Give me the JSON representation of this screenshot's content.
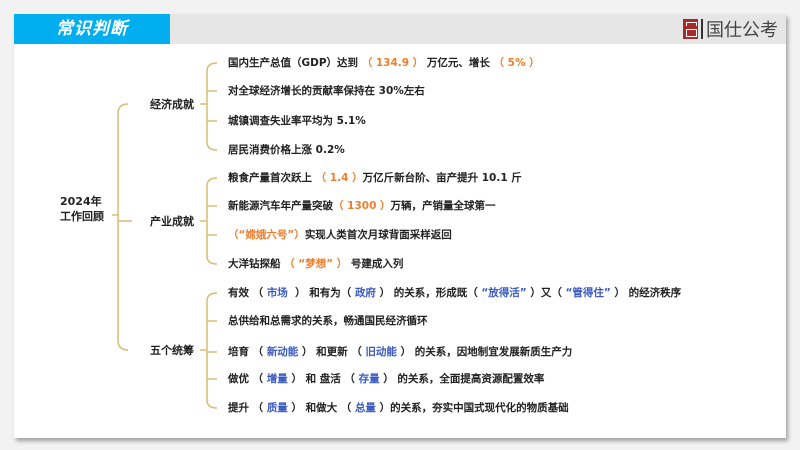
{
  "header": {
    "title": "常识判断",
    "logo_text": "国仕公考"
  },
  "colors": {
    "accent": "#00aeef",
    "orange": "#f07d2a",
    "blue": "#3b5bbf",
    "tree_line": "#d8bd72"
  },
  "root": {
    "label": "2024年工作回顾"
  },
  "branches": [
    {
      "label": "经济成就",
      "items": [
        [
          {
            "t": "国内生产总值（GDP）达到 "
          },
          {
            "t": "（ 134.9 ）",
            "h": "o"
          },
          {
            "t": " 万亿元、增长 "
          },
          {
            "t": "（ 5% ）",
            "h": "o"
          }
        ],
        [
          {
            "t": "对全球经济增长的贡献率保持在 30%左右"
          }
        ],
        [
          {
            "t": "城镇调查失业率平均为 5.1%"
          }
        ],
        [
          {
            "t": "居民消费价格上涨 0.2%"
          }
        ]
      ]
    },
    {
      "label": "产业成就",
      "items": [
        [
          {
            "t": "粮食产量首次跃上 "
          },
          {
            "t": "（ 1.4 ）",
            "h": "o"
          },
          {
            "t": "万亿斤新台阶、亩产提升 10.1 斤"
          }
        ],
        [
          {
            "t": "新能源汽车年产量突破"
          },
          {
            "t": "（ 1300 ）",
            "h": "o"
          },
          {
            "t": "万辆，产销量全球第一"
          }
        ],
        [
          {
            "t": "（“嫦娥六号”）",
            "h": "o"
          },
          {
            "t": "实现人类首次月球背面采样返回"
          }
        ],
        [
          {
            "t": "大洋钻探船 "
          },
          {
            "t": "（ “梦想” ）",
            "h": "o"
          },
          {
            "t": " 号建成入列"
          }
        ]
      ]
    },
    {
      "label": "五个统筹",
      "items": [
        [
          {
            "t": "有效 （ "
          },
          {
            "t": "市场",
            "h": "b"
          },
          {
            "t": "  ） 和有为（ "
          },
          {
            "t": "政府",
            "h": "b"
          },
          {
            "t": " ） 的关系，形成既（ "
          },
          {
            "t": "“放得活”",
            "h": "b"
          },
          {
            "t": " ）又（ "
          },
          {
            "t": "“管得住”",
            "h": "b"
          },
          {
            "t": " ） 的经济秩序"
          }
        ],
        [
          {
            "t": "总供给和总需求的关系，畅通国民经济循环"
          }
        ],
        [
          {
            "t": "培育 （ "
          },
          {
            "t": "新动能",
            "h": "b"
          },
          {
            "t": " ） 和更新 （ "
          },
          {
            "t": "旧动能",
            "h": "b"
          },
          {
            "t": " ） 的关系，因地制宜发展新质生产力"
          }
        ],
        [
          {
            "t": "做优 （ "
          },
          {
            "t": "增量",
            "h": "b"
          },
          {
            "t": " ） 和 盘活 （ "
          },
          {
            "t": "存量",
            "h": "b"
          },
          {
            "t": " ） 的关系，全面提高资源配置效率"
          }
        ],
        [
          {
            "t": "提升 （ "
          },
          {
            "t": "质量",
            "h": "b"
          },
          {
            "t": " ） 和做大 （ "
          },
          {
            "t": "总量",
            "h": "b"
          },
          {
            "t": " ）的关系，夯实中国式现代化的物质基础"
          }
        ]
      ]
    }
  ]
}
